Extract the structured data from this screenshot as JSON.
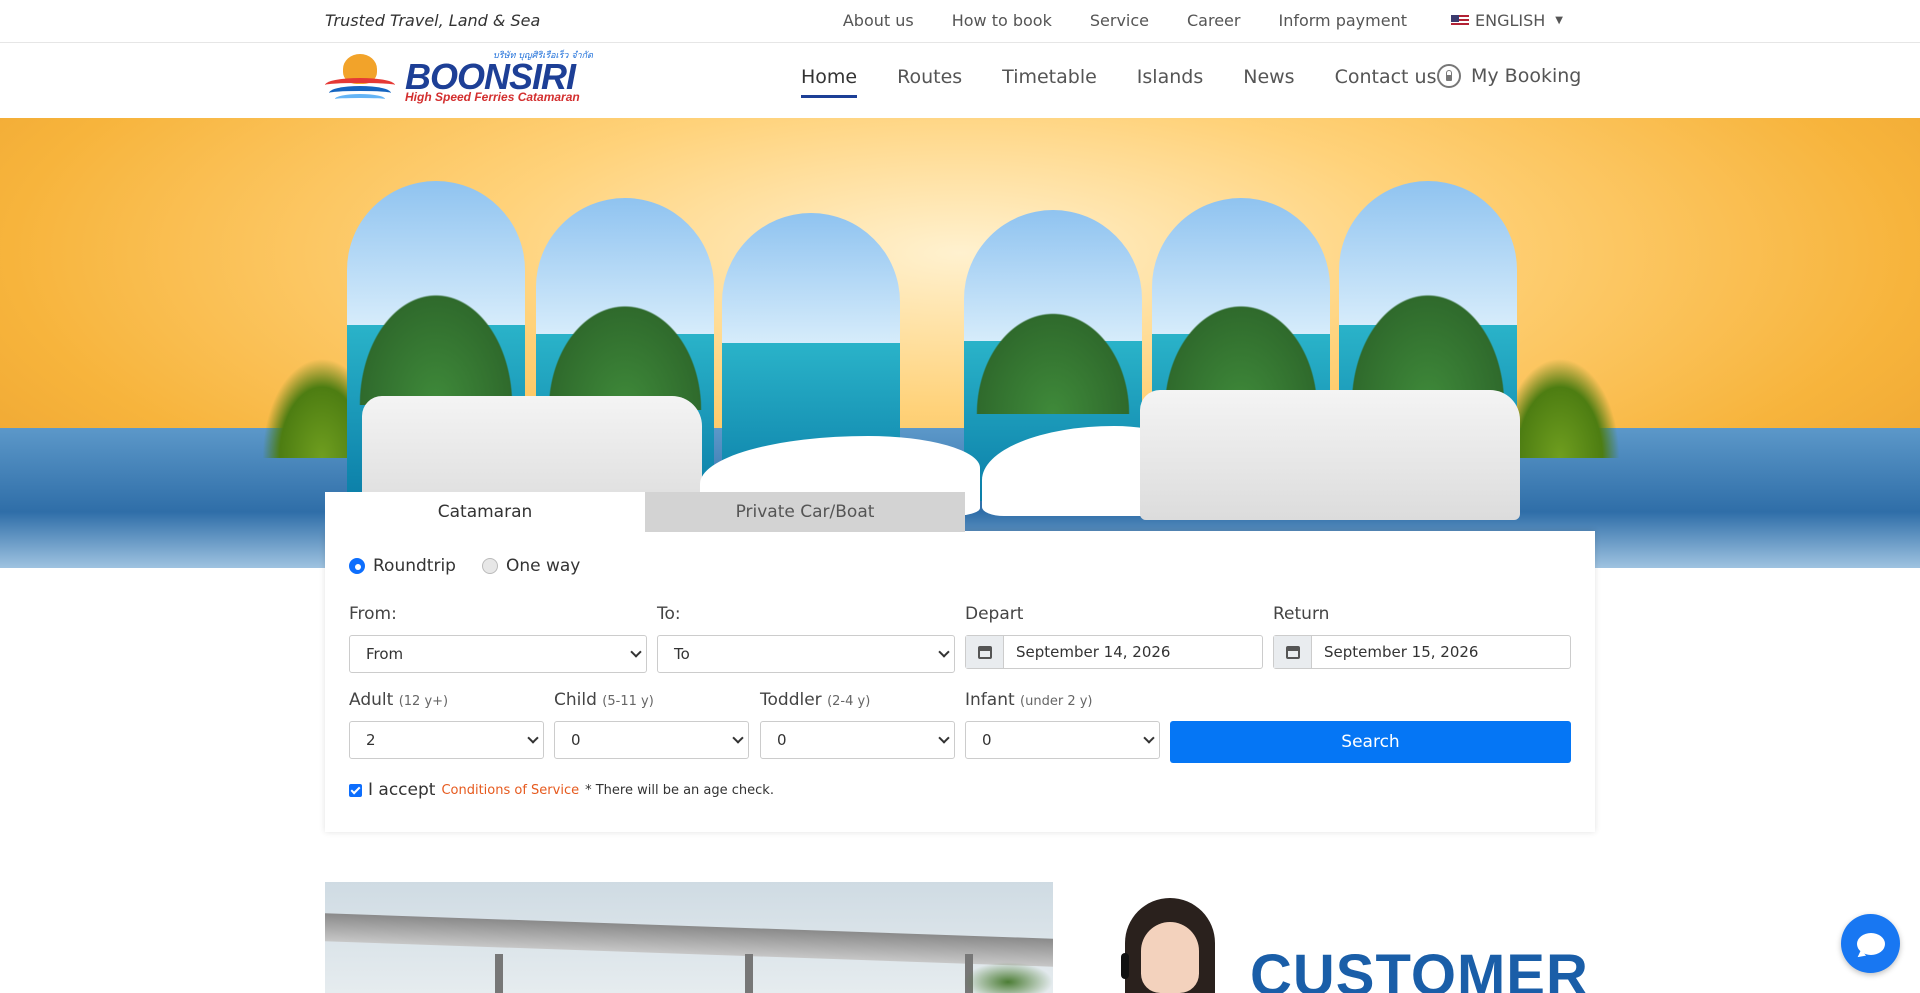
{
  "topbar": {
    "tagline": "Trusted Travel, Land & Sea",
    "links": [
      "About us",
      "How to book",
      "Service",
      "Career",
      "Inform payment"
    ],
    "language": "ENGLISH"
  },
  "logo": {
    "name": "BOONSIRI",
    "subtitle": "High Speed Ferries Catamaran",
    "thai": "บริษัท บุญศิริเรือเร็ว จำกัด"
  },
  "nav": {
    "items": [
      "Home",
      "Routes",
      "Timetable",
      "Islands",
      "News",
      "Contact us"
    ],
    "active": "Home",
    "my_booking": "My Booking"
  },
  "booking": {
    "tabs": [
      "Catamaran",
      "Private Car/Boat"
    ],
    "active_tab": "Catamaran",
    "trip_types": [
      "Roundtrip",
      "One way"
    ],
    "selected_trip": "Roundtrip",
    "from_label": "From:",
    "from_value": "From",
    "to_label": "To:",
    "to_value": "To",
    "depart_label": "Depart",
    "depart_value": "September 14, 2026",
    "return_label": "Return",
    "return_value": "September 15, 2026",
    "adult_label": "Adult",
    "adult_note": "(12 y+)",
    "adult_value": "2",
    "child_label": "Child",
    "child_note": "(5-11 y)",
    "child_value": "0",
    "toddler_label": "Toddler",
    "toddler_note": "(2-4 y)",
    "toddler_value": "0",
    "infant_label": "Infant",
    "infant_note": "(under 2 y)",
    "infant_value": "0",
    "search_label": "Search",
    "accept_label": "I accept",
    "conditions_link": "Conditions of Service",
    "age_check_note": "* There will be an age check.",
    "accept_checked": true
  },
  "promo": {
    "headline": "CUSTOMER"
  },
  "colors": {
    "primary": "#0576f5",
    "brand_navy": "#1d3f96",
    "link_orange": "#e65a1e"
  }
}
